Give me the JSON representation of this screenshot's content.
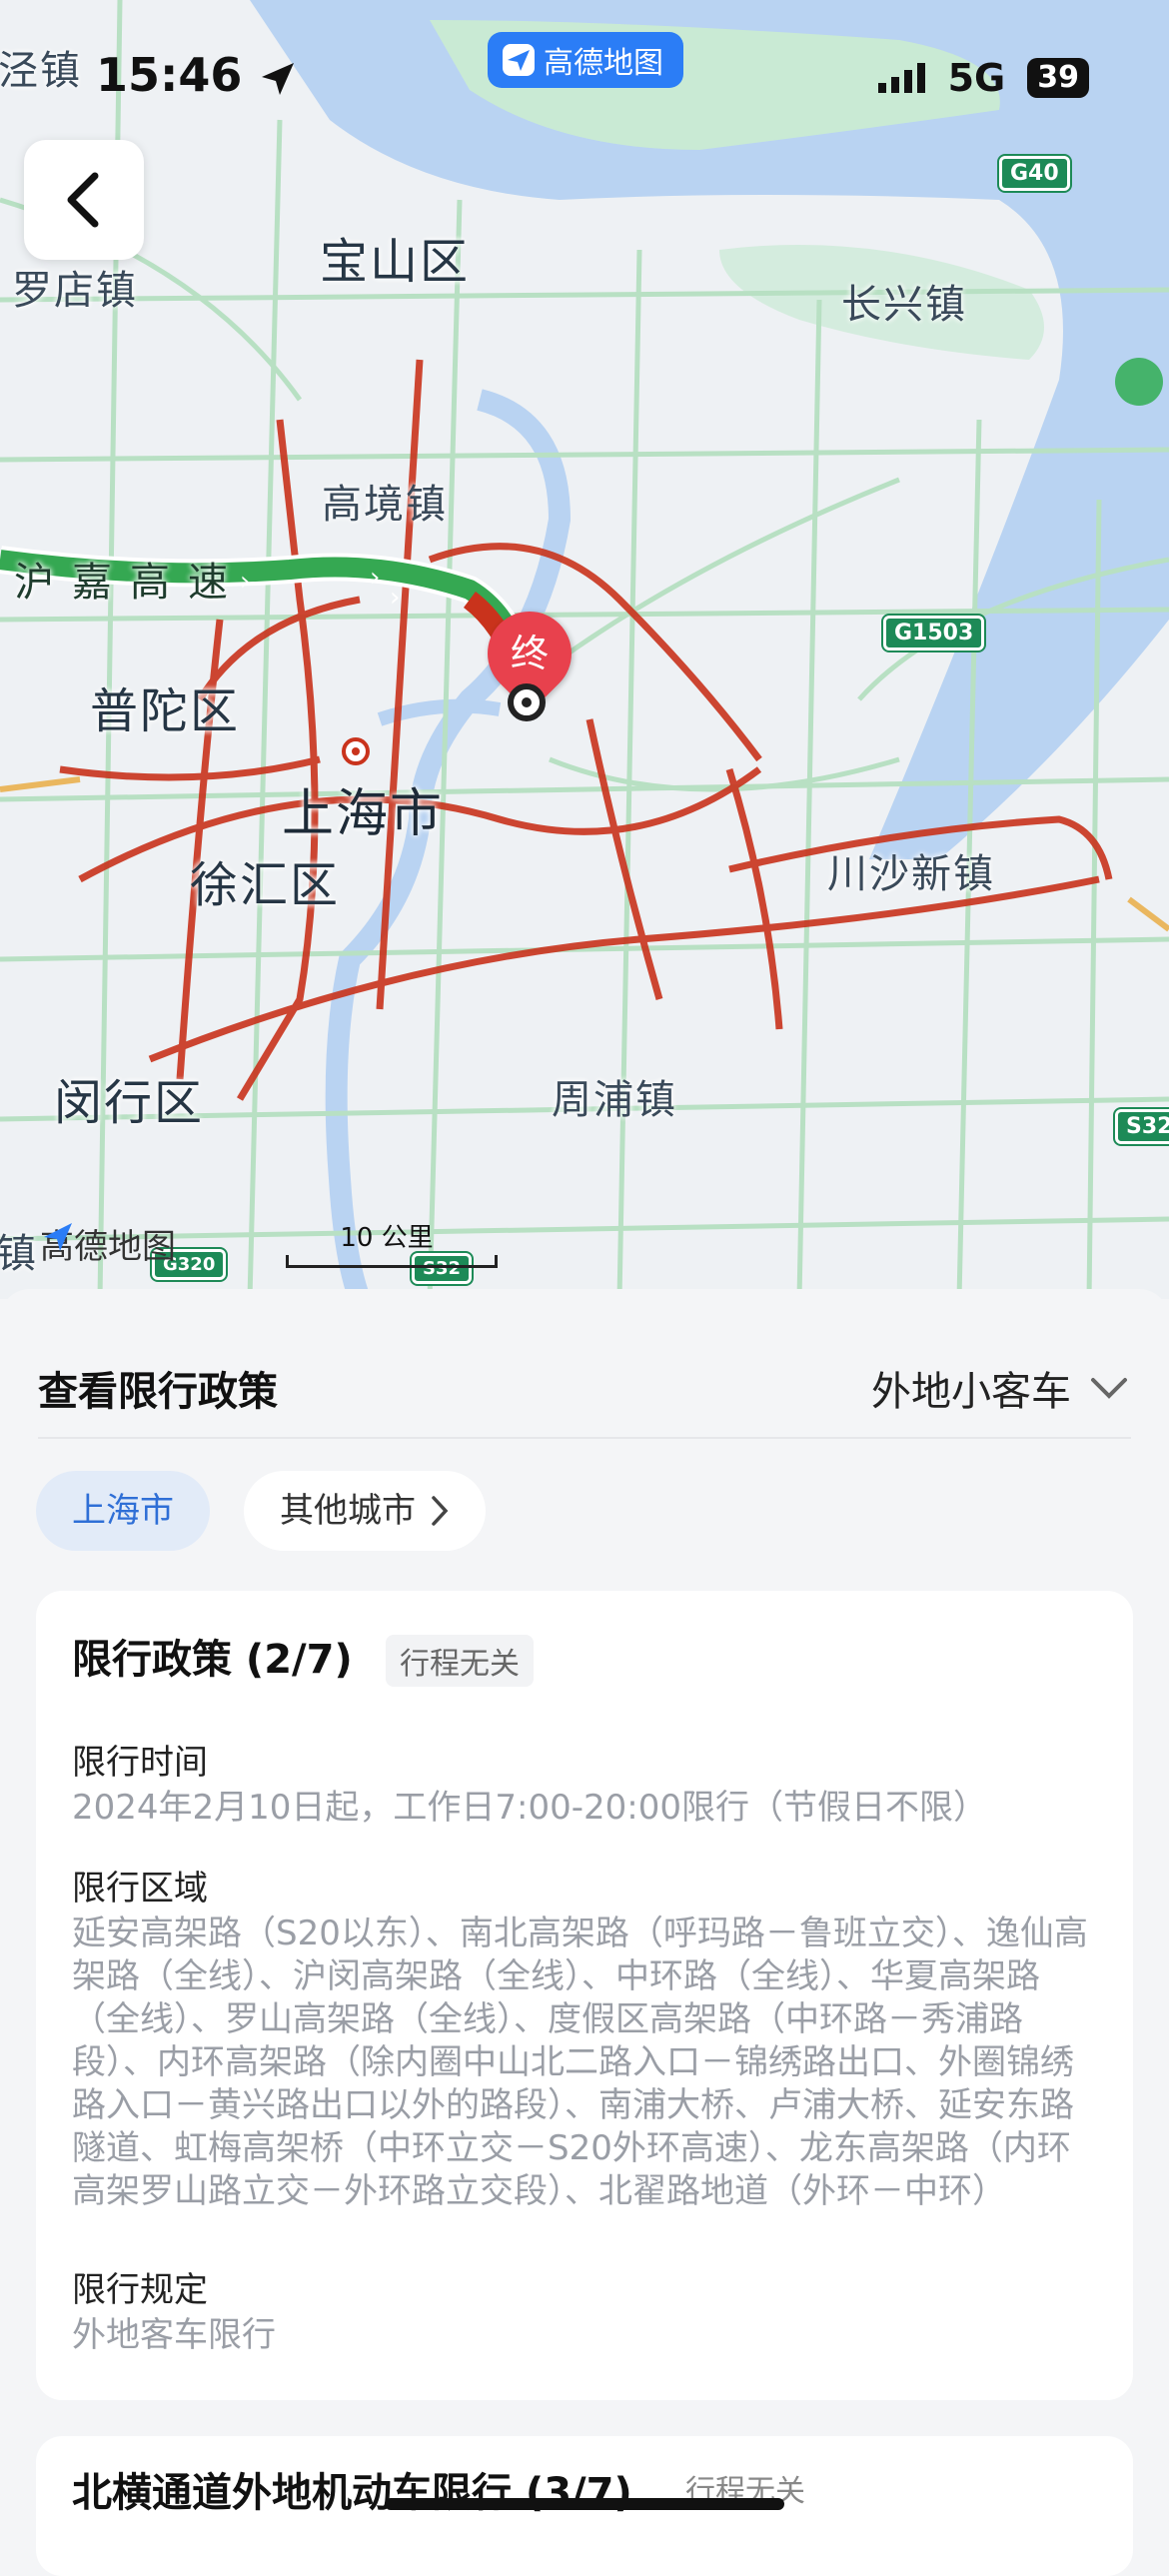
{
  "status_bar": {
    "time": "15:46",
    "network": "5G",
    "battery": "39"
  },
  "app_badge": {
    "label": "高德地图"
  },
  "map": {
    "places": {
      "luodian": "罗店镇",
      "baoshan": "宝山区",
      "changxing": "长兴镇",
      "gaojing": "高境镇",
      "hujia": "沪嘉高速",
      "putuo": "普陀区",
      "shanghai": "上海市",
      "xuhui": "徐汇区",
      "chuansha": "川沙新镇",
      "zhoupu": "周浦镇",
      "minhang": "闵行区",
      "top_left": "泾镇",
      "bottom_left": "镇"
    },
    "shields": {
      "g40": "G40",
      "g1503": "G1503",
      "s32": "S32",
      "g320": "G320",
      "s32b": "S32"
    },
    "end_marker": "终",
    "logo": "高德地图",
    "scale": "10 公里",
    "colors": {
      "route": "#35a852",
      "congestion": "#c9331c",
      "slow": "#e9a93a",
      "water": "#b9d3f2",
      "green": "#c9ead4"
    }
  },
  "policy": {
    "header": "查看限行政策",
    "vehicle_type": "外地小客车",
    "chips": {
      "current": "上海市",
      "other": "其他城市"
    },
    "card": {
      "title": "限行政策 (2/7)",
      "tag": "行程无关",
      "time_label": "限行时间",
      "time_value": "2024年2月10日起，工作日7:00-20:00限行（节假日不限）",
      "area_label": "限行区域",
      "area_value": "延安高架路（S20以东）、南北高架路（呼玛路－鲁班立交）、逸仙高架路（全线）、沪闵高架路（全线）、中环路（全线）、华夏高架路（全线）、罗山高架路（全线）、度假区高架路（中环路－秀浦路段）、内环高架路（除内圈中山北二路入口－锦绣路出口、外圈锦绣路入口－黄兴路出口以外的路段）、南浦大桥、卢浦大桥、延安东路隧道、虹梅高架桥（中环立交－S20外环高速）、龙东高架路（内环高架罗山路立交－外环路立交段）、北翟路地道（外环－中环）",
      "rule_label": "限行规定",
      "rule_value": "外地客车限行"
    },
    "next_card": {
      "title": "北横通道外地机动车限行 (3/7)",
      "tag": "行程无关"
    }
  }
}
